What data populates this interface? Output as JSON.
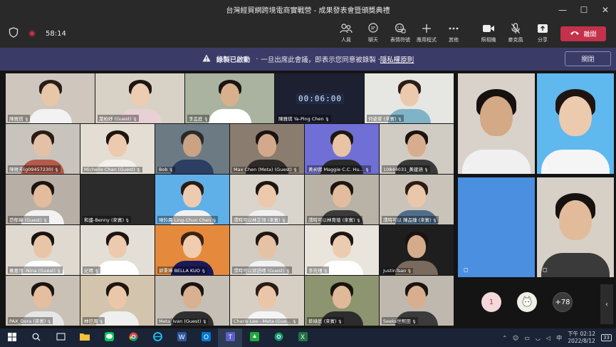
{
  "window": {
    "title": "台灣經貿網跨境電商實戰營 - 成果發表會暨頒獎典禮",
    "minimize": "—",
    "maximize": "☐",
    "close": "✕"
  },
  "toolbar": {
    "timer": "58:14",
    "buttons": [
      {
        "label": "人員",
        "icon": "people-icon"
      },
      {
        "label": "聊天",
        "icon": "chat-icon"
      },
      {
        "label": "表情符號",
        "icon": "emoji-icon"
      },
      {
        "label": "應用程式",
        "icon": "apps-icon"
      },
      {
        "label": "其他",
        "icon": "more-icon"
      },
      {
        "label": "照相機",
        "icon": "camera-icon"
      },
      {
        "label": "麥克風",
        "icon": "mic-off-icon"
      },
      {
        "label": "分享",
        "icon": "share-icon"
      }
    ],
    "leave_label": "離開"
  },
  "banner": {
    "bold": "錄製已啟動",
    "text": "一旦出席此會議，即表示您同意被錄製 ·",
    "link": "隱私權原則",
    "close_label": "關閉"
  },
  "gallery": {
    "clock": "00:06:00",
    "tiles": [
      {
        "name": "陳雅琪",
        "bg": "#cfc7bd",
        "skin": "#e8c6a8",
        "hair": "#2a1d18",
        "shirt": "#f2f2f2"
      },
      {
        "name": "葉柏妤 (Guest)",
        "bg": "#d8d2c6",
        "skin": "#edcdb2",
        "hair": "#1f1612",
        "shirt": "#e8d0d4"
      },
      {
        "name": "李孟庭",
        "bg": "#a9b3a0",
        "skin": "#d9b08e",
        "hair": "#1b1412",
        "shirt": "#ffffff"
      },
      {
        "name": "陳雅琪 Ya-Ping Chen",
        "bg": "#1d2030",
        "skin": "",
        "hair": "",
        "shirt": ""
      },
      {
        "name": "何姿萱 (來賓)",
        "bg": "#e6e6e2",
        "skin": "#ebc9ad",
        "hair": "#2b1e17",
        "shirt": "#7fb3c8"
      },
      {
        "name": "陳雅芳(g09457230)",
        "bg": "#c9c3bd",
        "skin": "#e3c1a6",
        "hair": "#2a1b14",
        "shirt": "#b35a4a"
      },
      {
        "name": "Michelle Chan (Guest)",
        "bg": "#e3ddd3",
        "skin": "#eccaae",
        "hair": "#1e1410",
        "shirt": "#f3f0ec"
      },
      {
        "name": "Bob",
        "bg": "#6c7a84",
        "skin": "#c9a384",
        "hair": "#2a2a2a",
        "shirt": "#2c3e62"
      },
      {
        "name": "Max Chen (Meta) (Guest)",
        "bg": "#8a7d70",
        "skin": "#d2a98a",
        "hair": "#1a1410",
        "shirt": "#2e2a28"
      },
      {
        "name": "黃昶蓉 Maggie C.C. Hu...",
        "bg": "#6f6fd6",
        "skin": "#e8c4a5",
        "hair": "#201611",
        "shirt": "#2a2a2a"
      },
      {
        "name": "10844031_黃建涵",
        "bg": "#d1ccc3",
        "skin": "#d8ad8d",
        "hair": "#1a1311",
        "shirt": "#3a3a3a"
      },
      {
        "name": "范郁瑋 (Guest)",
        "bg": "#b8b0a6",
        "skin": "#e2bc9c",
        "hair": "#1c1411",
        "shirt": "#f2f2f2"
      },
      {
        "name": "和盛-Benny (來賓)",
        "bg": "#2b2b2b",
        "skin": "",
        "hair": "",
        "shirt": ""
      },
      {
        "name": "陳鈴晨 Ling-Chun Chen",
        "bg": "#5fb0e8",
        "skin": "#edcbb0",
        "hair": "#2a1b14",
        "shirt": "#f2f2f2"
      },
      {
        "name": "謂時可以林芷翎 (來賓)",
        "bg": "#d9d4cc",
        "skin": "#ecc9ac",
        "hair": "#1e1511",
        "shirt": "#f0f0f0"
      },
      {
        "name": "謂時可以林育瑄 (來賓)",
        "bg": "#b9b2a7",
        "skin": "#e2bd9d",
        "hair": "#1e1511",
        "shirt": "#3b3b3b"
      },
      {
        "name": "謂時可以 陳品臻 (來賓)",
        "bg": "#cac3b9",
        "skin": "#eac7aa",
        "hair": "#2c1c14",
        "shirt": "#4f6e8a"
      },
      {
        "name": "羅嘉翎 -Nina (Guest)",
        "bg": "#dfd9d0",
        "skin": "#e8c5a7",
        "hair": "#1a1310",
        "shirt": "#ffffff"
      },
      {
        "name": "紀晴",
        "bg": "#e4dfd6",
        "skin": "#eccaae",
        "hair": "#1e1511",
        "shirt": "#ffffff"
      },
      {
        "name": "郭秉璋 BELLA KUO",
        "bg": "#e58a3c",
        "skin": "#f1cdb0",
        "hair": "#3a2410",
        "shirt": "#1a1a5a"
      },
      {
        "name": "謂時可以郭語晴 (Guest)",
        "bg": "#d2ccc2",
        "skin": "#e6c2a4",
        "hair": "#201611",
        "shirt": "#f2f2f2"
      },
      {
        "name": "李宛瑾",
        "bg": "#e9e4dc",
        "skin": "#ecccb1",
        "hair": "#1f1612",
        "shirt": "#ffffff"
      },
      {
        "name": "JustinTsao",
        "bg": "#1e1e1e",
        "skin": "#d4ab8b",
        "hair": "#1a1310",
        "shirt": "#7a6a5e"
      },
      {
        "name": "PAX_Dora (來賓)",
        "bg": "#c9c1b6",
        "skin": "#e3bf9f",
        "hair": "#1b1410",
        "shirt": "#e6e6e6"
      },
      {
        "name": "林巨周",
        "bg": "#d3c4ae",
        "skin": "#ebc7a9",
        "hair": "#1e1511",
        "shirt": "#efefef"
      },
      {
        "name": "Meta_Ivan (Guest)",
        "bg": "#c6bfb5",
        "skin": "#dab190",
        "hair": "#1a1310",
        "shirt": "#2f2f2f"
      },
      {
        "name": "Charis Lee - Meta (Gue...",
        "bg": "#d7cfc4",
        "skin": "#e9c6a8",
        "hair": "#2a1c14",
        "shirt": "#f5f5f5"
      },
      {
        "name": "蔡綠庭 (來賓)",
        "bg": "#8d9470",
        "skin": "#e0b999",
        "hair": "#1a1410",
        "shirt": "#2c2c2c"
      },
      {
        "name": "Seeks世熙田",
        "bg": "#bfb8ae",
        "skin": "#d8ae8e",
        "hair": "#1a1310",
        "shirt": "#3b3b3b"
      }
    ]
  },
  "side_tiles": [
    {
      "bg": "#d8d2ca",
      "skin": "#d4a986",
      "hair": "#16110e",
      "shirt": "#f0f0f0"
    },
    {
      "bg": "#5fb8ee",
      "skin": "#eccaae",
      "hair": "#1e1511",
      "shirt": "#f5f5f5"
    },
    {
      "bg": "#4a8fe0",
      "skin": "",
      "hair": "",
      "shirt": ""
    },
    {
      "bg": "#d6d0c7",
      "skin": "#e2bc9a",
      "hair": "#171210",
      "shirt": "#3a3a3a"
    }
  ],
  "roster": {
    "count_badge": "1",
    "more_label": "+78"
  },
  "taskbar": {
    "time": "下午 02:12",
    "date": "2022/8/12",
    "notif": "33"
  }
}
